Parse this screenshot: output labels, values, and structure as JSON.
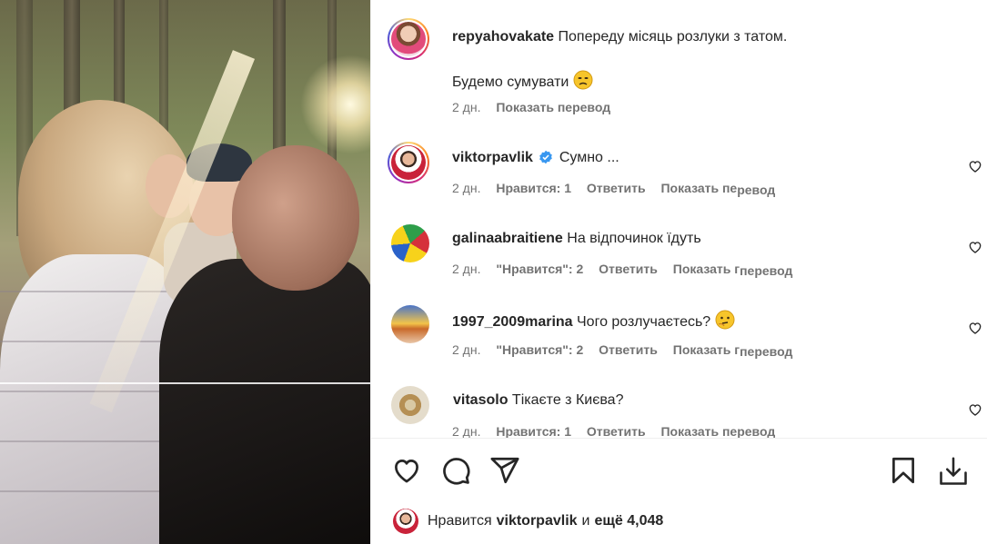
{
  "comments": [
    {
      "username": "repyahovakate",
      "text": "Попереду місяць розлу",
      "text_cont": "ки з татом.",
      "text2": "Будемо сумувати",
      "time": "2 дн.",
      "translate": "Показать перевод"
    },
    {
      "username": "viktorpavlik",
      "text": "Сумно ...",
      "time": "2 дн.",
      "likes": "Нравится: 1",
      "reply": "Ответить",
      "translate": "Показать пе",
      "translate_cont": "ревод"
    },
    {
      "username": "galinaabraitiene",
      "text": "На відпочинок їдуть",
      "time": "2 дн.",
      "likes": "\"Нравится\": 2",
      "reply": "Ответить",
      "translate": "Показать г",
      "translate_cont": "перевод"
    },
    {
      "username": "1997_2009marina",
      "text": "Чого розлучаєтесь?",
      "time": "2 дн.",
      "likes": "\"Нравится\": 2",
      "reply": "Ответить",
      "translate": "Показать г",
      "translate_cont": "перевод"
    },
    {
      "username": "vitasolo",
      "text": "Тікаєте з Києва?",
      "time": "2 дн.",
      "likes": "Нравится: 1",
      "reply": "Ответить",
      "translate": "Показать перевод"
    }
  ],
  "likes_summary": {
    "prefix": "Нравится",
    "user": "viktorpavlik",
    "middle": "и",
    "count": "ещё 4,048"
  },
  "icons": {
    "like": "heart-icon",
    "comment": "comment-icon",
    "share": "share-icon",
    "save": "bookmark-icon",
    "download": "download-icon",
    "verified": "verified-badge-icon"
  },
  "colors": {
    "verified": "#3897f0",
    "text": "#262626",
    "meta": "#737373"
  }
}
